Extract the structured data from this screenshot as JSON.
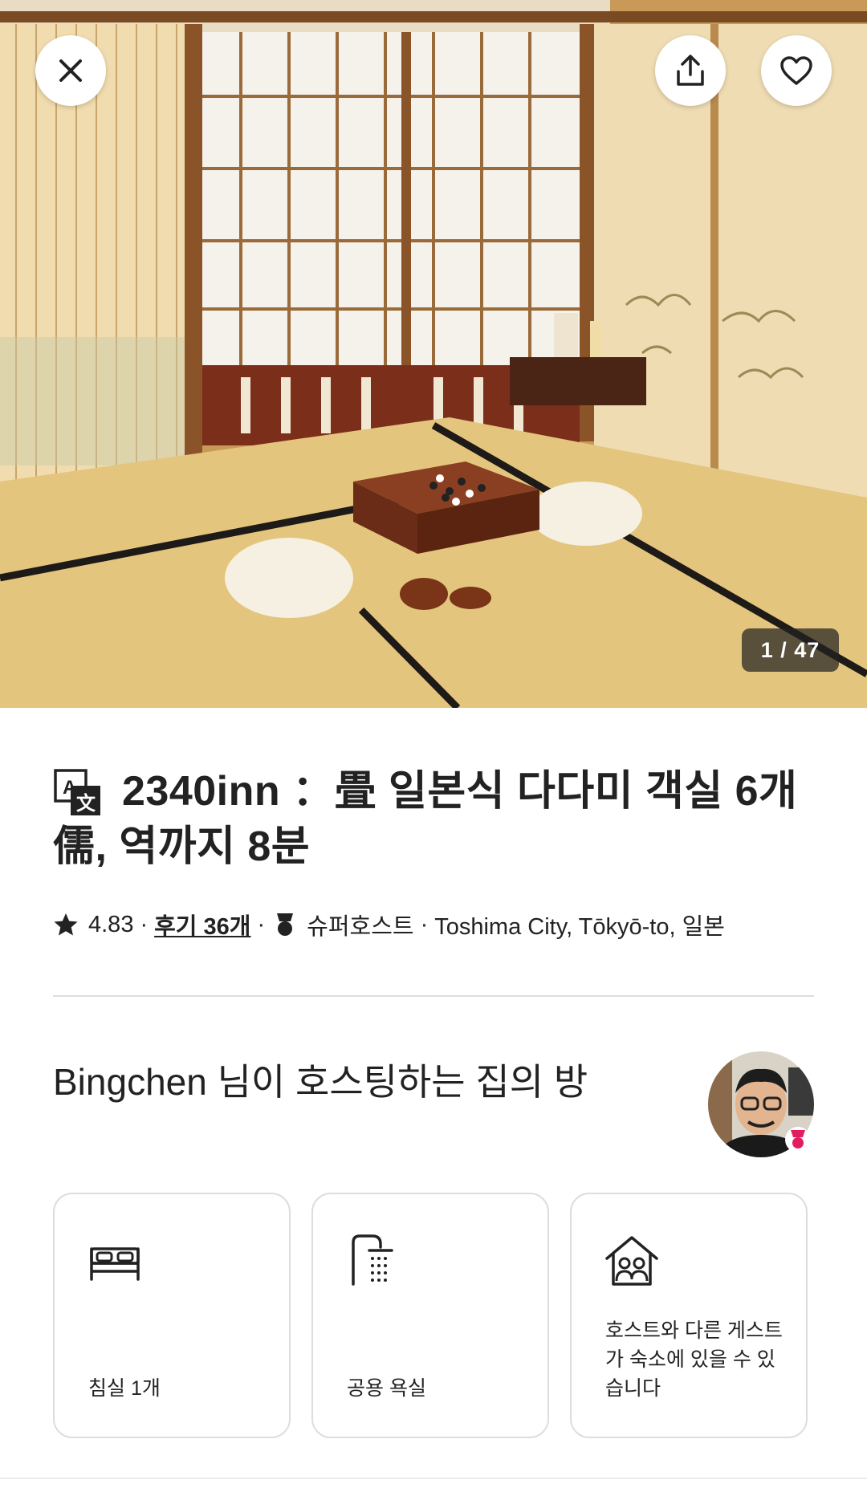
{
  "photo": {
    "counter": "1 / 47",
    "description_icon": "photo-japanese-tatami-room"
  },
  "buttons": {
    "close_icon": "close-icon",
    "share_icon": "share-icon",
    "save_icon": "heart-icon"
  },
  "listing": {
    "title": "2340inn ：畳 일본식 다다미 객실 6개儒, 역까지 8분",
    "rating": "4.83",
    "reviews": "후기 36개",
    "superhost": "슈퍼호스트",
    "location": "Toshima City, Tōkyō-to, 일본"
  },
  "host": {
    "title": "Bingchen 님이 호스팅하는 집의 방"
  },
  "features": [
    {
      "icon": "bed-icon",
      "label": "침실 1개"
    },
    {
      "icon": "shower-icon",
      "label": "공용 욕실"
    },
    {
      "icon": "shared-home-icon",
      "label": "호스트와 다른 게스트가 숙소에 있을 수 있습니다"
    }
  ],
  "colors": {
    "accent": "#E31C5F",
    "text": "#222222",
    "border": "#DDDDDD"
  }
}
